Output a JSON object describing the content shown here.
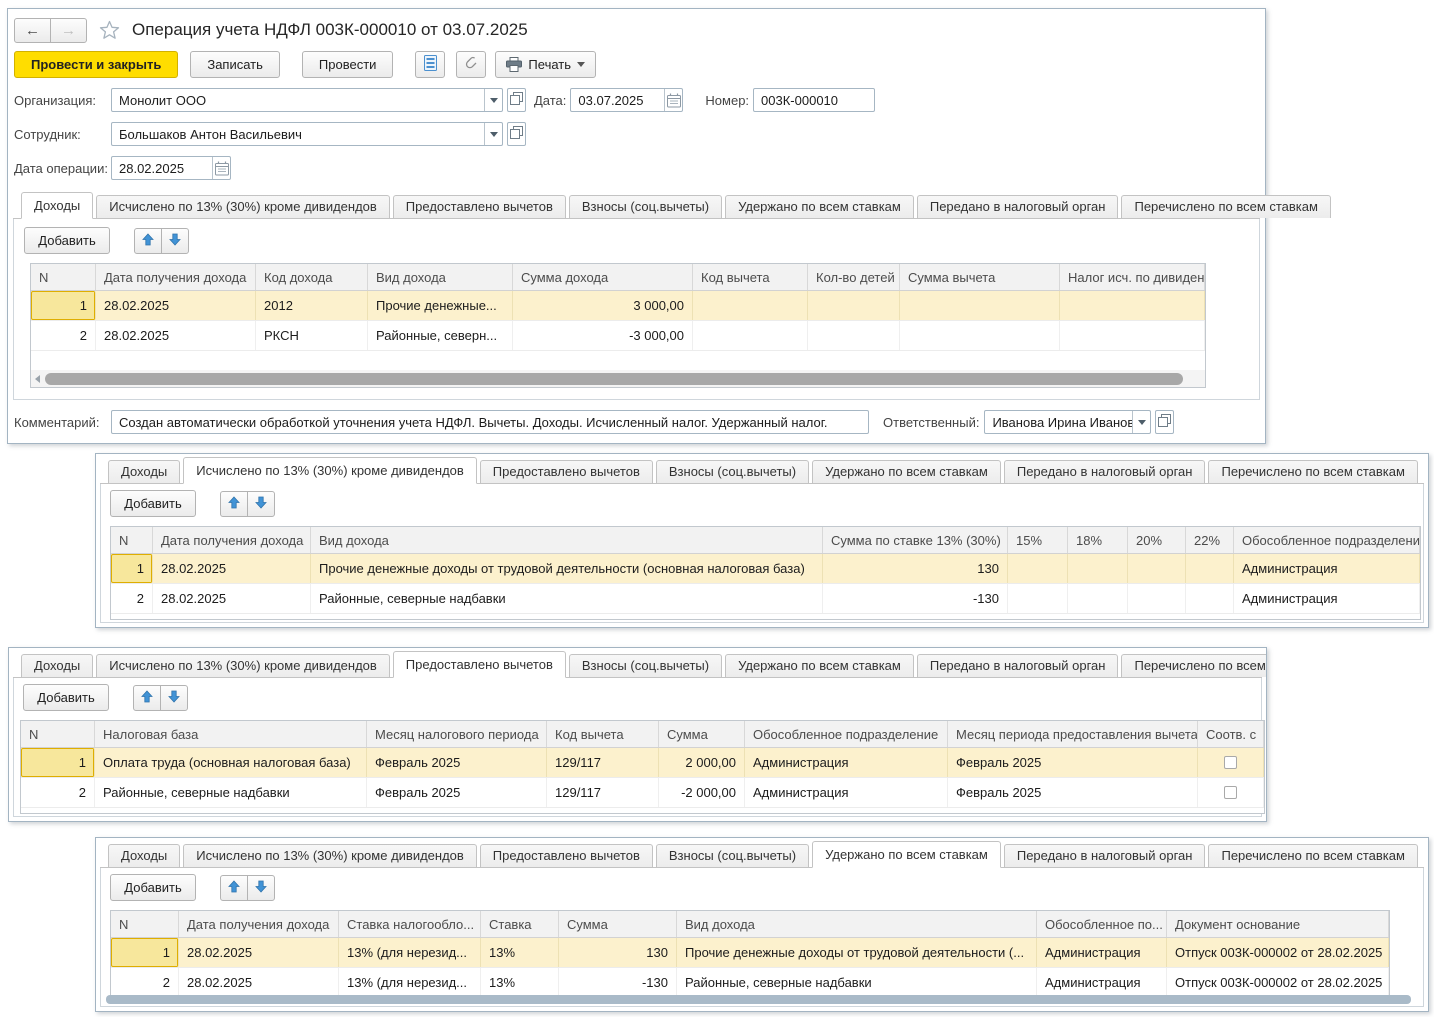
{
  "header": {
    "title": "Операция учета НДФЛ 003К-000010 от 03.07.2025",
    "buttons": {
      "post_and_close": "Провести и закрыть",
      "write": "Записать",
      "post": "Провести",
      "print": "Печать"
    }
  },
  "icons": {
    "back": "←",
    "forward": "→",
    "favorite": "star",
    "register": "register",
    "attachment": "paperclip",
    "printer": "printer",
    "dropdown": "▾",
    "calendar": "calendar",
    "open": "⧉",
    "move_up": "↑",
    "move_down": "↓"
  },
  "fields": {
    "organization": {
      "label": "Организация:",
      "value": "Монолит ООО"
    },
    "date": {
      "label": "Дата:",
      "value": "03.07.2025"
    },
    "number": {
      "label": "Номер:",
      "value": "003К-000010"
    },
    "employee": {
      "label": "Сотрудник:",
      "value": "Большаков Антон Васильевич"
    },
    "operation_date": {
      "label": "Дата операции:",
      "value": "28.02.2025"
    }
  },
  "footer": {
    "comment": {
      "label": "Комментарий:",
      "value": "Создан автоматически обработкой уточнения учета НДФЛ. Вычеты. Доходы. Исчисленный налог. Удержанный налог."
    },
    "responsible": {
      "label": "Ответственный:",
      "value": "Иванова Ирина Ивановна"
    }
  },
  "tabs": [
    "Доходы",
    "Исчислено по 13% (30%) кроме дивидендов",
    "Предоставлено вычетов",
    "Взносы (соц.вычеты)",
    "Удержано по всем ставкам",
    "Передано в налоговый орган",
    "Перечислено по всем ставкам"
  ],
  "add_button_label": "Добавить",
  "panels": {
    "incomes": {
      "active_tab": "Доходы",
      "columns": [
        "N",
        "Дата получения дохода",
        "Код дохода",
        "Вид дохода",
        "Сумма дохода",
        "Код вычета",
        "Кол-во детей",
        "Сумма вычета",
        "Налог исч. по дивидендам"
      ],
      "rows": [
        [
          "1",
          "28.02.2025",
          "2012",
          "Прочие денежные...",
          "3 000,00",
          "",
          "",
          "",
          ""
        ],
        [
          "2",
          "28.02.2025",
          "РКСН",
          "Районные, северн...",
          "-3 000,00",
          "",
          "",
          "",
          ""
        ]
      ]
    },
    "calculated": {
      "active_tab": "Исчислено по 13% (30%) кроме дивидендов",
      "columns": [
        "N",
        "Дата получения дохода",
        "Вид дохода",
        "Сумма по ставке 13% (30%)",
        "15%",
        "18%",
        "20%",
        "22%",
        "Обособленное подразделение"
      ],
      "rows": [
        [
          "1",
          "28.02.2025",
          "Прочие денежные доходы от трудовой деятельности (основная налоговая база)",
          "130",
          "",
          "",
          "",
          "",
          "Администрация"
        ],
        [
          "2",
          "28.02.2025",
          "Районные, северные надбавки",
          "-130",
          "",
          "",
          "",
          "",
          "Администрация"
        ]
      ]
    },
    "deductions": {
      "active_tab": "Предоставлено вычетов",
      "columns": [
        "N",
        "Налоговая база",
        "Месяц налогового периода",
        "Код вычета",
        "Сумма",
        "Обособленное подразделение",
        "Месяц периода предоставления вычета",
        "Соотв. с"
      ],
      "rows": [
        [
          "1",
          "Оплата труда (основная налоговая база)",
          "Февраль 2025",
          "129/117",
          "2 000,00",
          "Администрация",
          "Февраль 2025",
          ""
        ],
        [
          "2",
          "Районные, северные надбавки",
          "Февраль 2025",
          "129/117",
          "-2 000,00",
          "Администрация",
          "Февраль 2025",
          ""
        ]
      ],
      "checkbox_column": "Соотв. с",
      "checkboxes": [
        false,
        false
      ]
    },
    "withheld": {
      "active_tab": "Удержано по всем ставкам",
      "columns": [
        "N",
        "Дата получения дохода",
        "Ставка налогообло...",
        "Ставка",
        "Сумма",
        "Вид дохода",
        "Обособленное по...",
        "Документ основание"
      ],
      "rows": [
        [
          "1",
          "28.02.2025",
          "13% (для нерезид...",
          "13%",
          "130",
          "Прочие денежные доходы от трудовой деятельности (...",
          "Администрация",
          "Отпуск 003К-000002 от 28.02.2025"
        ],
        [
          "2",
          "28.02.2025",
          "13% (для нерезид...",
          "13%",
          "-130",
          "Районные, северные надбавки",
          "Администрация",
          "Отпуск 003К-000002 от 28.02.2025"
        ]
      ]
    }
  },
  "colors": {
    "primary_button": "#ffdd00",
    "selected_row": "#fcf1cd",
    "current_cell_border": "#dfae00",
    "arrow_blue": "#4193d6"
  }
}
